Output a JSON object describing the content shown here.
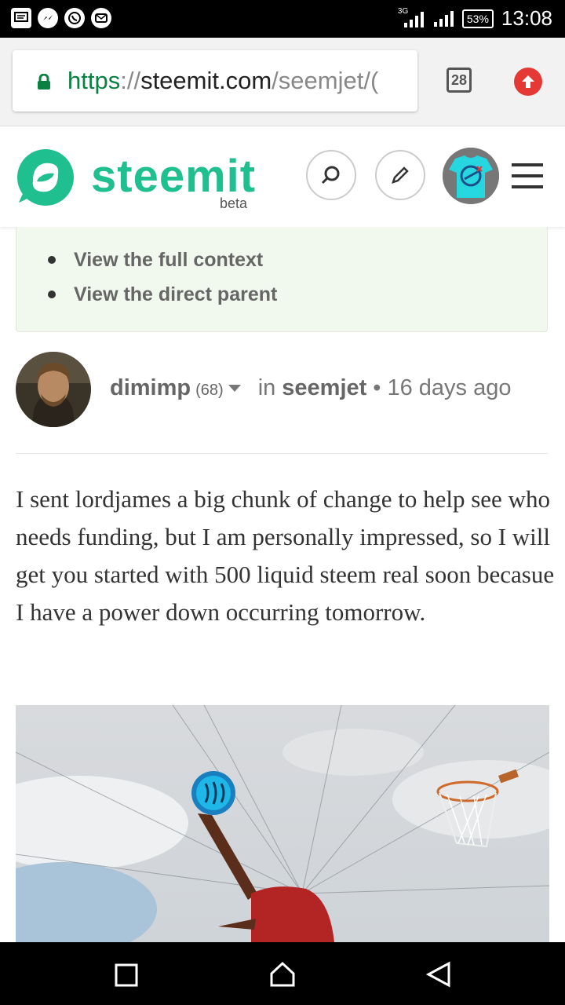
{
  "status_bar": {
    "network_label": "3G",
    "battery": "53%",
    "time": "13:08",
    "left_icons": [
      "message-icon",
      "messenger-icon",
      "whatsapp-icon",
      "mail-icon"
    ]
  },
  "browser": {
    "url_scheme": "https",
    "url_sep": "://",
    "url_host": "steemit.com",
    "url_path": "/seemjet/(",
    "tab_count": "28"
  },
  "site": {
    "brand": "steemit",
    "beta": "beta",
    "brand_color": "#1fbf8f"
  },
  "context": {
    "links": [
      "View the full context",
      "View the direct parent"
    ]
  },
  "post": {
    "author": "dimimp",
    "reputation": "(68)",
    "in_label": "in",
    "category": "seemjet",
    "dot": "•",
    "age": "16 days ago",
    "body": "I sent lordjames a big chunk of change to help see who needs funding, but I am personally impressed, so I will get you started with 500 liquid steem real soon becasue I have a power down occurring tomorrow."
  },
  "colors": {
    "accent": "#1fbf8f",
    "secure_green": "#0b8043",
    "upload_red": "#e53935",
    "context_bg": "#f1f8ed"
  }
}
